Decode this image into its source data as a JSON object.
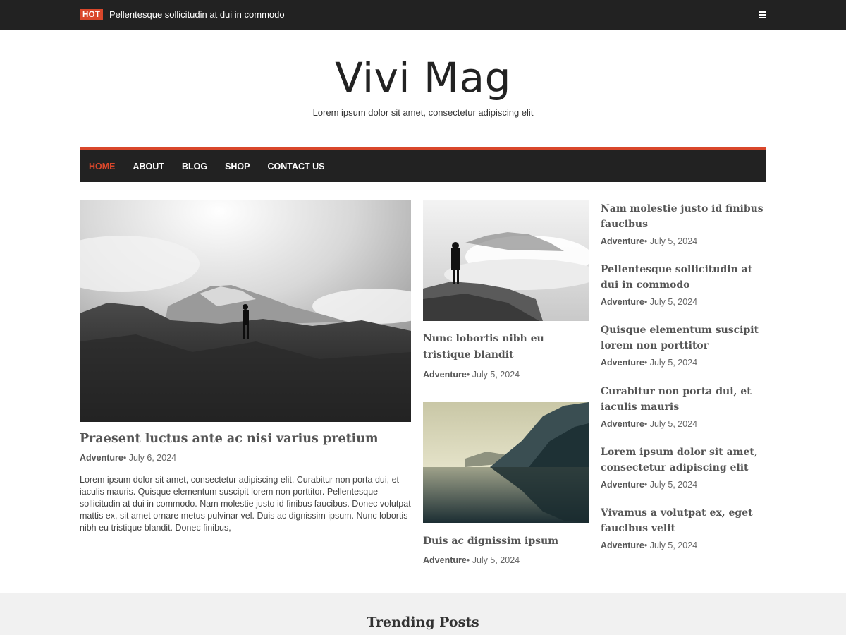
{
  "topbar": {
    "hot_label": "HOT",
    "ticker_text": "Pellentesque sollicitudin at dui in commodo",
    "menu_icon": "hamburger-menu-icon"
  },
  "header": {
    "title": "Vivi Mag",
    "tagline": "Lorem ipsum dolor sit amet, consectetur adipiscing elit"
  },
  "nav": {
    "items": [
      {
        "label": "HOME",
        "active": true
      },
      {
        "label": "ABOUT",
        "active": false
      },
      {
        "label": "BLOG",
        "active": false
      },
      {
        "label": "SHOP",
        "active": false
      },
      {
        "label": "CONTACT US",
        "active": false
      }
    ]
  },
  "featured": {
    "title": "Praesent luctus ante ac nisi varius pretium",
    "category": "Adventure",
    "date": "July 6, 2024",
    "excerpt": "Lorem ipsum dolor sit amet, consectetur adipiscing elit. Curabitur non porta dui, et iaculis mauris. Quisque elementum suscipit lorem non porttitor. Pellentesque sollicitudin at dui in commodo. Nam molestie justo id finibus faucibus. Donec volutpat mattis ex, sit amet ornare metus pulvinar vel. Duis ac dignissim ipsum. Nunc lobortis nibh eu tristique blandit. Donec finibus,"
  },
  "middle_posts": [
    {
      "title": "Nunc lobortis nibh eu tristique blandit",
      "category": "Adventure",
      "date": "July 5, 2024"
    },
    {
      "title": "Duis ac dignissim ipsum",
      "category": "Adventure",
      "date": "July 5, 2024"
    }
  ],
  "side_posts": [
    {
      "title": "Nam molestie justo id finibus faucibus",
      "category": "Adventure",
      "date": "July 5, 2024"
    },
    {
      "title": "Pellentesque sollicitudin at dui in commodo",
      "category": "Adventure",
      "date": "July 5, 2024"
    },
    {
      "title": "Quisque elementum suscipit lorem non porttitor",
      "category": "Adventure",
      "date": "July 5, 2024"
    },
    {
      "title": "Curabitur non porta dui, et iaculis mauris",
      "category": "Adventure",
      "date": "July 5, 2024"
    },
    {
      "title": "Lorem ipsum dolor sit amet, consectetur adipiscing elit",
      "category": "Adventure",
      "date": "July 5, 2024"
    },
    {
      "title": "Vivamus a volutpat ex, eget faucibus velit",
      "category": "Adventure",
      "date": "July 5, 2024"
    }
  ],
  "meta_separator": "•",
  "trending": {
    "title": "Trending Posts"
  },
  "colors": {
    "accent": "#d9472b",
    "dark_bar": "#222222",
    "band": "#f1f1f1"
  }
}
